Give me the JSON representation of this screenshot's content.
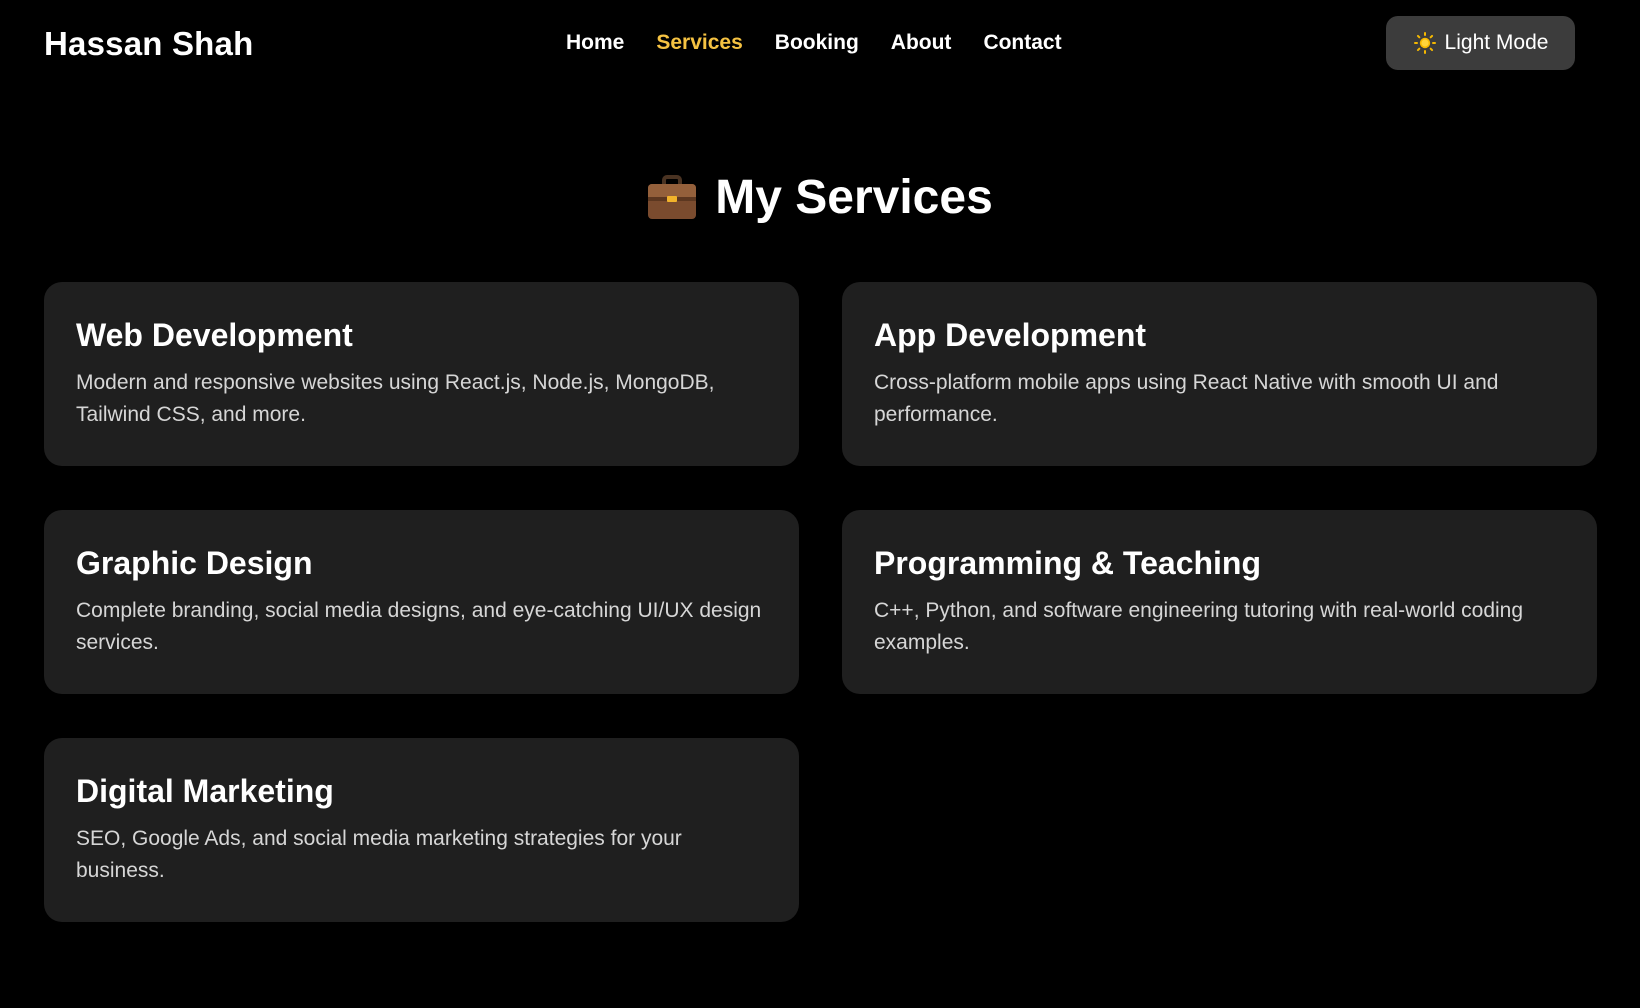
{
  "header": {
    "brand": "Hassan Shah",
    "nav": [
      {
        "label": "Home",
        "active": false
      },
      {
        "label": "Services",
        "active": true
      },
      {
        "label": "Booking",
        "active": false
      },
      {
        "label": "About",
        "active": false
      },
      {
        "label": "Contact",
        "active": false
      }
    ],
    "theme_toggle": {
      "label": "Light Mode",
      "icon": "sun-icon"
    }
  },
  "main": {
    "heading": {
      "icon": "briefcase-icon",
      "title": "My Services"
    },
    "services": [
      {
        "title": "Web Development",
        "description": "Modern and responsive websites using React.js, Node.js, MongoDB, Tailwind CSS, and more."
      },
      {
        "title": "App Development",
        "description": "Cross-platform mobile apps using React Native with smooth UI and performance."
      },
      {
        "title": "Graphic Design",
        "description": "Complete branding, social media designs, and eye-catching UI/UX design services."
      },
      {
        "title": "Programming & Teaching",
        "description": "C++, Python, and software engineering tutoring with real-world coding examples."
      },
      {
        "title": "Digital Marketing",
        "description": "SEO, Google Ads, and social media marketing strategies for your business."
      }
    ]
  },
  "colors": {
    "background": "#000000",
    "card": "#1f1f1f",
    "accent": "#f5c242",
    "toggle": "#3c3c3c"
  }
}
